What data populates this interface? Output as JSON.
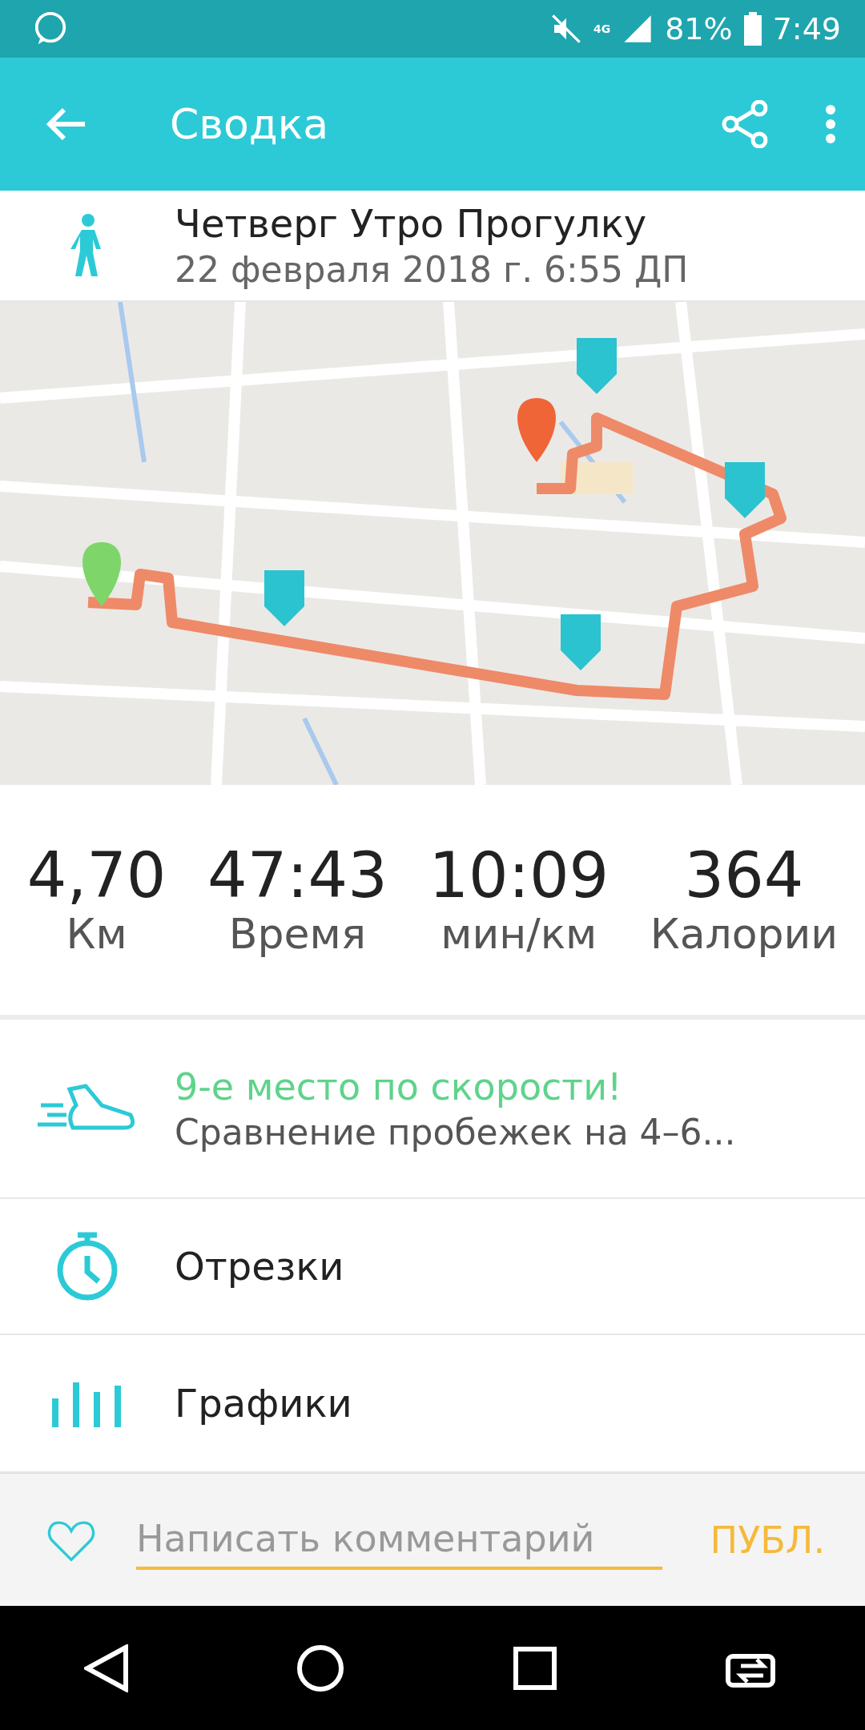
{
  "status_bar": {
    "network": "4G",
    "battery": "81%",
    "time": "7:49"
  },
  "toolbar": {
    "title": "Сводка"
  },
  "activity": {
    "title": "Четверг Утро Прогулку",
    "date": "22 февраля 2018 г. 6:55 ДП"
  },
  "stats": [
    {
      "value": "4,70",
      "label": "Км"
    },
    {
      "value": "47:43",
      "label": "Время"
    },
    {
      "value": "10:09",
      "label": "мин/км"
    },
    {
      "value": "364",
      "label": "Калории"
    }
  ],
  "sections": [
    {
      "kind": "ranking",
      "title": "9-е место по скорости!",
      "subtitle": "Сравнение пробежек на 4–6..."
    },
    {
      "kind": "splits",
      "title": "Отрезки"
    },
    {
      "kind": "charts",
      "title": "Графики"
    }
  ],
  "comment": {
    "liked": false,
    "placeholder": "Написать комментарий",
    "button": "ПУБЛ."
  }
}
